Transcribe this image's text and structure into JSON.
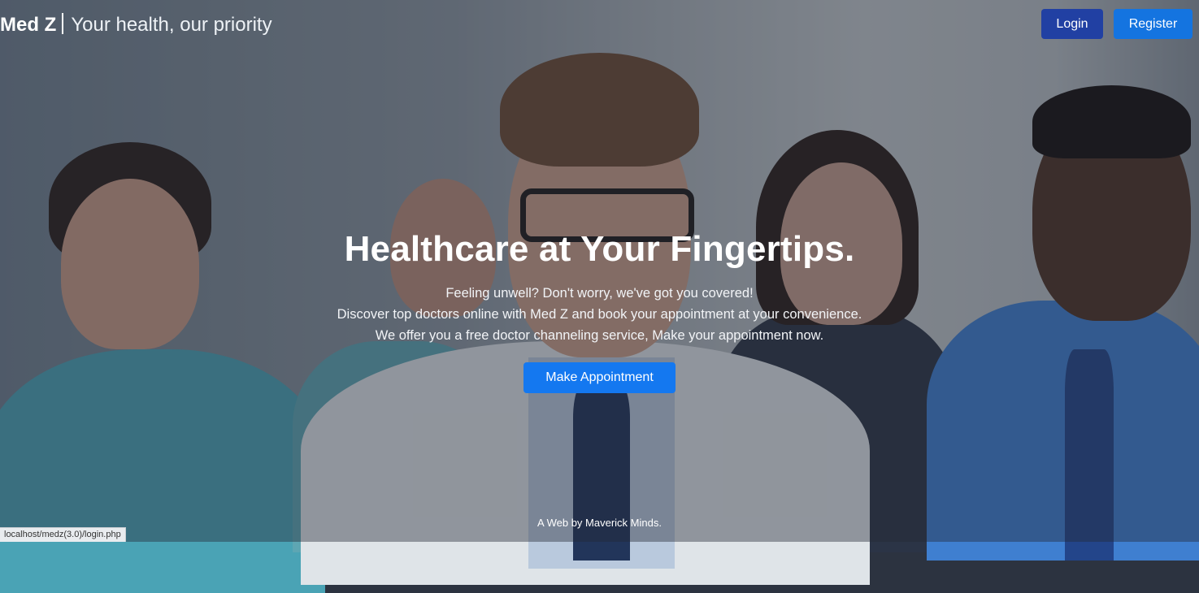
{
  "header": {
    "brand": "Med Z",
    "tagline": "Your health, our priority",
    "login_label": "Login",
    "register_label": "Register"
  },
  "hero": {
    "title": "Healthcare at Your Fingertips.",
    "lines": [
      "Feeling unwell? Don't worry, we've got you covered!",
      "Discover top doctors online with Med Z and book your appointment at your convenience.",
      "We offer you a free doctor channeling service, Make your appointment now."
    ],
    "cta_label": "Make Appointment"
  },
  "footer": {
    "credit": "A Web by Maverick Minds."
  },
  "status_bar": {
    "url": "localhost/medz(3.0)/login.php"
  },
  "colors": {
    "login_button": "#2140a3",
    "primary_button": "#1478f0"
  }
}
